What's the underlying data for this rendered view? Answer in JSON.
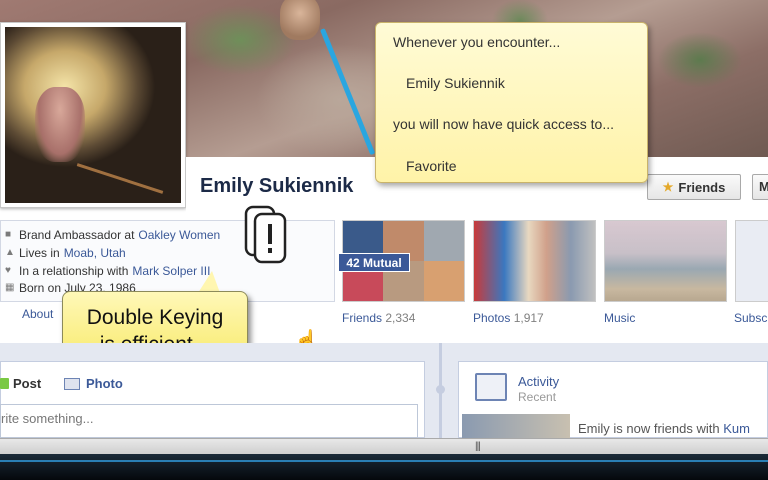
{
  "profile": {
    "name": "Emily Sukiennik",
    "friends_button": "Friends",
    "more_button": "M"
  },
  "tooltip": {
    "line1": "Whenever you encounter...",
    "line2": "Emily Sukiennik",
    "line3": "you will now have quick access to...",
    "line4": "Favorite"
  },
  "info": {
    "row1_prefix": "Brand Ambassador at ",
    "row1_link": "Oakley Women",
    "row2_prefix": "Lives in ",
    "row2_link": "Moab, Utah",
    "row3_prefix": "In a relationship with ",
    "row3_link": "Mark Solper III",
    "row4": "Born on July 23, 1986",
    "about_link": "About"
  },
  "thumbnails": {
    "mutual_badge": "42 Mutual",
    "friends_label": "Friends",
    "friends_count": "2,334",
    "photos_label": "Photos",
    "photos_count": "1,917",
    "music_label": "Music",
    "subs_label": "Subscr"
  },
  "callout": {
    "line1": "Double Keying",
    "line2": "is efficient..."
  },
  "composer": {
    "post_tab": "Post",
    "photo_tab": "Photo",
    "placeholder": "rite something..."
  },
  "activity": {
    "title": "Activity",
    "subtitle": "Recent",
    "item_prefix": "Emily is now friends with ",
    "item_link": "Kum"
  },
  "colors": {
    "link": "#3b5998",
    "callout_bg": "#f7e860",
    "tooltip_bg": "#fff3a8",
    "rope": "#2aa6e0"
  }
}
